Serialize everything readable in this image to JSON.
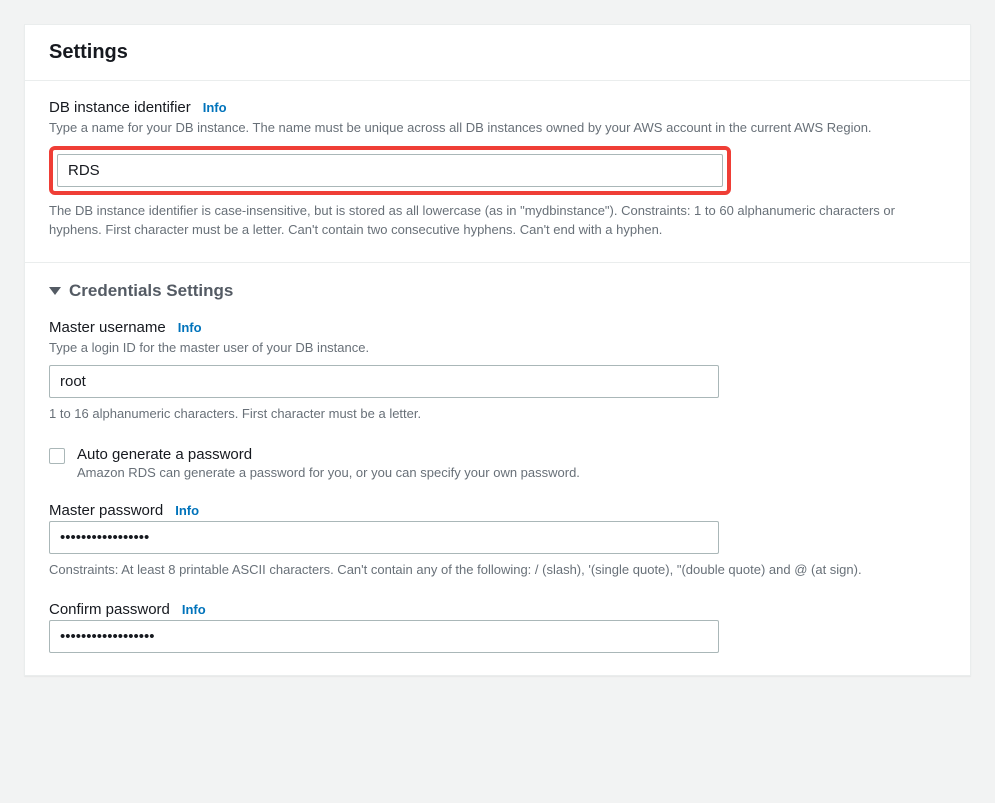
{
  "panel": {
    "title": "Settings"
  },
  "db_identifier": {
    "label": "DB instance identifier",
    "info": "Info",
    "desc": "Type a name for your DB instance. The name must be unique across all DB instances owned by your AWS account in the current AWS Region.",
    "value": "RDS",
    "hint": "The DB instance identifier is case-insensitive, but is stored as all lowercase (as in \"mydbinstance\"). Constraints: 1 to 60 alphanumeric characters or hyphens. First character must be a letter. Can't contain two consecutive hyphens. Can't end with a hyphen."
  },
  "credentials": {
    "heading": "Credentials Settings",
    "master_username": {
      "label": "Master username",
      "info": "Info",
      "desc": "Type a login ID for the master user of your DB instance.",
      "value": "root",
      "hint": "1 to 16 alphanumeric characters. First character must be a letter."
    },
    "auto_generate": {
      "label": "Auto generate a password",
      "desc": "Amazon RDS can generate a password for you, or you can specify your own password."
    },
    "master_password": {
      "label": "Master password",
      "info": "Info",
      "value": "•••••••••••••••••",
      "hint": "Constraints: At least 8 printable ASCII characters. Can't contain any of the following: / (slash), '(single quote), \"(double quote) and @ (at sign)."
    },
    "confirm_password": {
      "label": "Confirm password",
      "info": "Info",
      "value": "••••••••••••••••••"
    }
  }
}
